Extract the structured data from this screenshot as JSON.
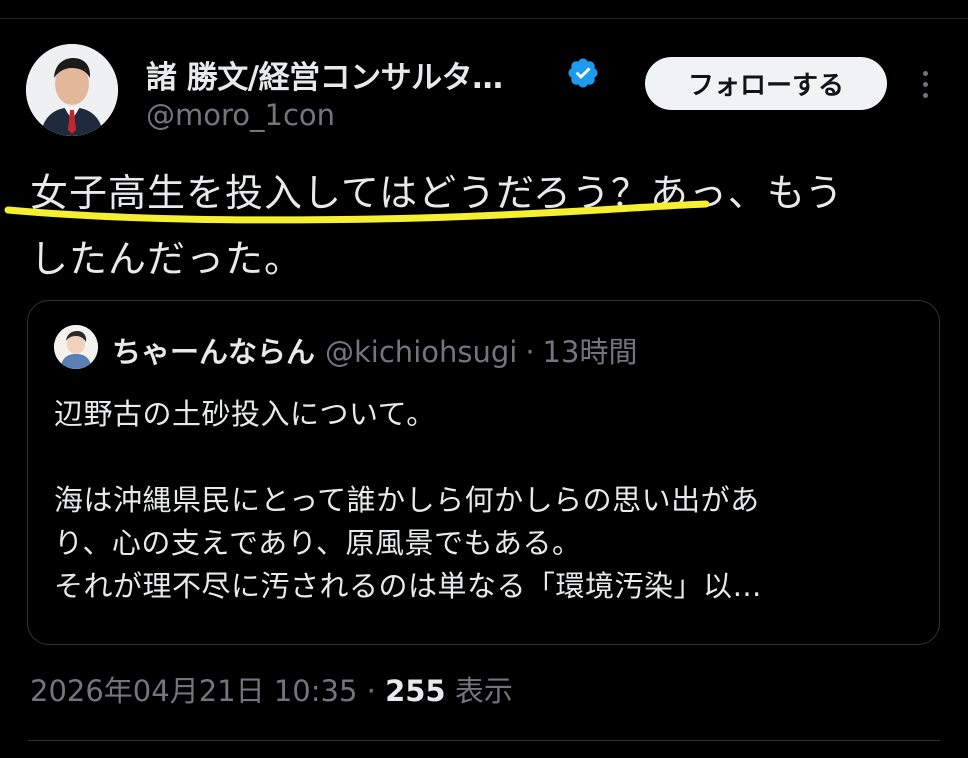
{
  "author": {
    "display_name": "諸 勝文/経営コンサルタ…",
    "handle": "@moro_1con",
    "avatar_icon": "person-photo-avatar",
    "verified_icon": "verified-badge-icon",
    "verified_color": "#1d9bf0"
  },
  "actions": {
    "follow_label": "フォローする",
    "more_icon": "more-vertical-icon"
  },
  "tweet": {
    "text_highlighted": "女子高生を投入してはどうだろう？",
    "text_rest": "あっ、もう",
    "text_line2": "したんだった。",
    "highlight_color": "#f5ef2f"
  },
  "quote": {
    "display_name": "ちゃーんならん",
    "handle": "@kichiohsugi",
    "separator": "·",
    "time": "13時間",
    "lines": [
      "辺野古の土砂投入について。",
      "",
      "海は沖縄県民にとって誰かしら何かしらの思い出があ",
      "り、心の支えであり、原風景でもある。",
      "それが理不尽に汚されるのは単なる「環境汚染」以…"
    ]
  },
  "meta": {
    "timestamp": "2026年04月21日 10:35",
    "separator": "·",
    "views_count": "255",
    "views_label": "表示"
  },
  "colors": {
    "background": "#000000",
    "text": "#e7e9ea",
    "muted": "#71767b",
    "border": "#2f3336"
  }
}
